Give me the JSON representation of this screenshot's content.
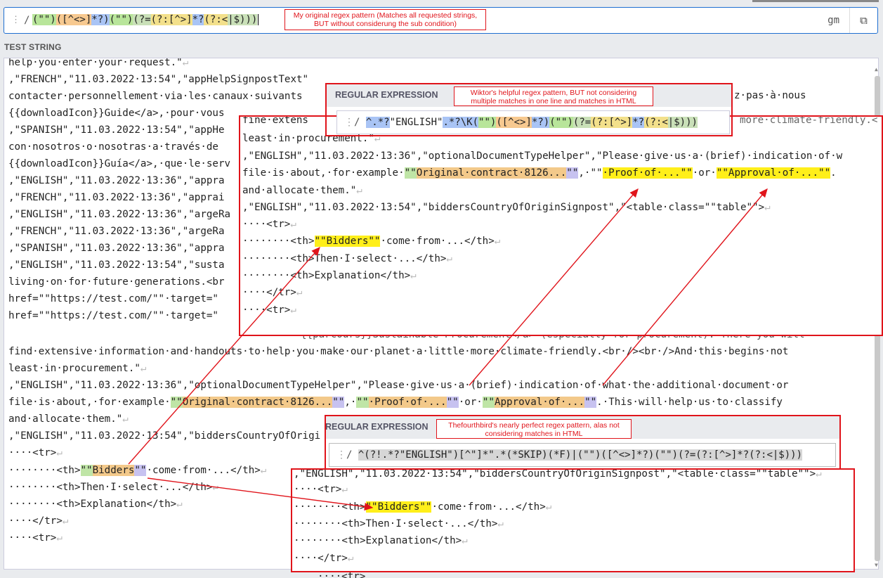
{
  "top_bar": {
    "delimiter": "/",
    "pattern_tokens": [
      "(\"\")",
      "([^<>]",
      "*?)",
      "(\"\")",
      "(?=",
      "(?:[^>]",
      "*?",
      "(?:<",
      "|$)))"
    ],
    "flags": "gm",
    "copy_icon": "copy-icon"
  },
  "notes": {
    "note1": "My original regex pattern (Matches all requested strings, BUT without considerung the sub condition)",
    "note2": "Wiktor's helpful regex pattern, BUT not considering multiple matches in one line and matches in HTML",
    "note3": "Thefourthbird's nearly perfect regex pattern, alas not considering matches in HTML"
  },
  "test_string_label": "TEST STRING",
  "editor_lines": [
    "help·you·enter·your·request.\"",
    ",\"FRENCH\",\"11.03.2022·13:54\",\"appHelpSignpostText\"",
    "contacter·personnellement·via·les·canaux·suivants",
    "{{downloadIcon}}Guide</a>,·pour·vous",
    ",\"SPANISH\",\"11.03.2022·13:54\",\"appHe",
    "con·nosotros·o·nosotras·a·través·de",
    "{{downloadIcon}}Guía</a>,·que·le·serv",
    ",\"ENGLISH\",\"11.03.2022·13:36\",\"appra",
    ",\"FRENCH\",\"11.03.2022·13:36\",\"apprai",
    ",\"ENGLISH\",\"11.03.2022·13:36\",\"argeRa",
    ",\"FRENCH\",\"11.03.2022·13:36\",\"argeRa",
    ",\"SPANISH\",\"11.03.2022·13:36\",\"appra",
    ",\"ENGLISH\",\"11.03.2022·13:54\",\"susta",
    "living·on·for·future·generations.<br",
    "href=\"\"https://test.com/\"\"·target=\"",
    "href=\"\"https://test.com/\"\"·target=\"",
    "find·extensive·information·and·handouts·to·help·you·make·our·planet·a·little·more·climate-friendly.<br·/><br·/>And·this·begins·not",
    "least·in·procurement.\"",
    ",\"ENGLISH\",\"11.03.2022·13:36\",\"optionalDocumentTypeHelper\",\"Please·give·us·a·(brief)·indication·of·what·the·additional·document·or",
    "file·is·about,·for·example·",
    "and·allocate·them.\"",
    ",\"ENGLISH\",\"11.03.2022·13:54\",\"biddersCountryOfOrigi",
    "····<tr>",
    "········<th>",
    "········<th>Then·I·select·...</th>",
    "········<th>Explanation</th>",
    "····</tr>",
    "····<tr>"
  ],
  "inline_matches": {
    "original_contract": "\"\"Original·contract·8126...\"\"",
    "proof_of": "\"\"·Proof·of·...\"\"",
    "or_word": "·or·",
    "approval_of": "\"\"Approval·of·...\"\"",
    "tail_sentence": ".·This·will·help·us·to·classify",
    "bidders": "\"\"Bidders\"\"",
    "come_from": "·come·from·...</th>"
  },
  "panel2": {
    "header": "REGULAR EXPRESSION",
    "pattern_tokens": [
      "^.*?",
      "\"ENGLISH\"",
      ".*?\\K(",
      "\"\")",
      "([^<>]",
      "*?)",
      "(\"\")",
      "(?=",
      "(?:[^>]",
      "*?",
      "(?:<",
      "|$)))"
    ],
    "lines": [
      "fine·extens",
      "least·in·procurement.\"",
      ",\"ENGLISH\",\"11.03.2022·13:36\",\"optionalDocumentTypeHelper\",\"Please·give·us·a·(brief)·indication·of·w",
      "file·is·about,·for·example·",
      "and·allocate·them.\"",
      ",\"ENGLISH\",\"11.03.2022·13:54\",\"biddersCountryOfOriginSignpost\",\"<table·class=\"\"table\"\">",
      "····<tr>",
      "········<th>",
      "········<th>Then·I·select·...</th>",
      "········<th>Explanation</th>",
      "····</tr>",
      "····<tr>"
    ],
    "tail_right": "more·climate-friendly.<"
  },
  "panel3": {
    "header": "REGULAR EXPRESSION",
    "pattern": "^(?!.*?\"ENGLISH\")[^\"]*\".*(*SKIP)(*F)|(\"\")([^<>]*?)(\"\")(?=(?:[^>]*?(?:<|$)))",
    "lines": [
      ",\"ENGLISH\",\"11.03.2022·13:54\",\"biddersCountryOfOriginSignpost\",\"<table·class=\"\"table\"\">",
      "····<tr>",
      "········<th>",
      "········<th>Then·I·select·...</th>",
      "········<th>Explanation</th>",
      "····</tr>",
      "····<tr>"
    ]
  },
  "bg_fragments": {
    "frag_nous": "z·pas·à·nous",
    "frag_parcours": "{{parcours}}Sustainable·Procurement</a>·(especially·for·procurement).·There·you·will"
  },
  "colors": {
    "accent": "#1f6fd1",
    "annotation": "#e0141b",
    "match_yellow": "#ffef1a",
    "match_orange": "#f3c98a",
    "match_green": "#bfe5a6",
    "match_purple": "#c7c2f0"
  }
}
